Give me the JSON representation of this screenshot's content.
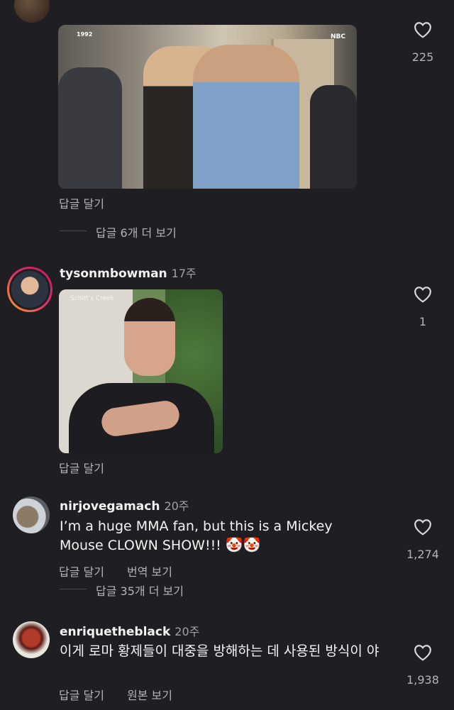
{
  "comments": [
    {
      "likes": "225",
      "reply_label": "답글 달기",
      "view_replies": "답글 6개 더 보기",
      "gif_caption": "1992",
      "gif_channel": "NBC"
    },
    {
      "username": "tysonmbowman",
      "time": "17주",
      "likes": "1",
      "reply_label": "답글 달기",
      "gif_watermark": "Schitt's Creek"
    },
    {
      "username": "nirjovegamach",
      "time": "20주",
      "text": "I’m a huge MMA fan, but this is a Mickey Mouse CLOWN SHOW!!!",
      "emoji": "🤡🤡",
      "likes": "1,274",
      "reply_label": "답글 달기",
      "translate_label": "번역 보기",
      "view_replies": "답글 35개 더 보기"
    },
    {
      "username": "enriquetheblack",
      "time": "20주",
      "text": "이게 로마 황제들이 대중을 방해하는 데 사용된 방식이 야",
      "likes": "1,938",
      "reply_label": "답글 달기",
      "original_label": "원본 보기"
    }
  ],
  "icons": {
    "like": "heart-outline-icon"
  },
  "colors": {
    "background": "#1f1f23",
    "story_ring_start": "#f9a825",
    "story_ring_end": "#c2185b"
  }
}
